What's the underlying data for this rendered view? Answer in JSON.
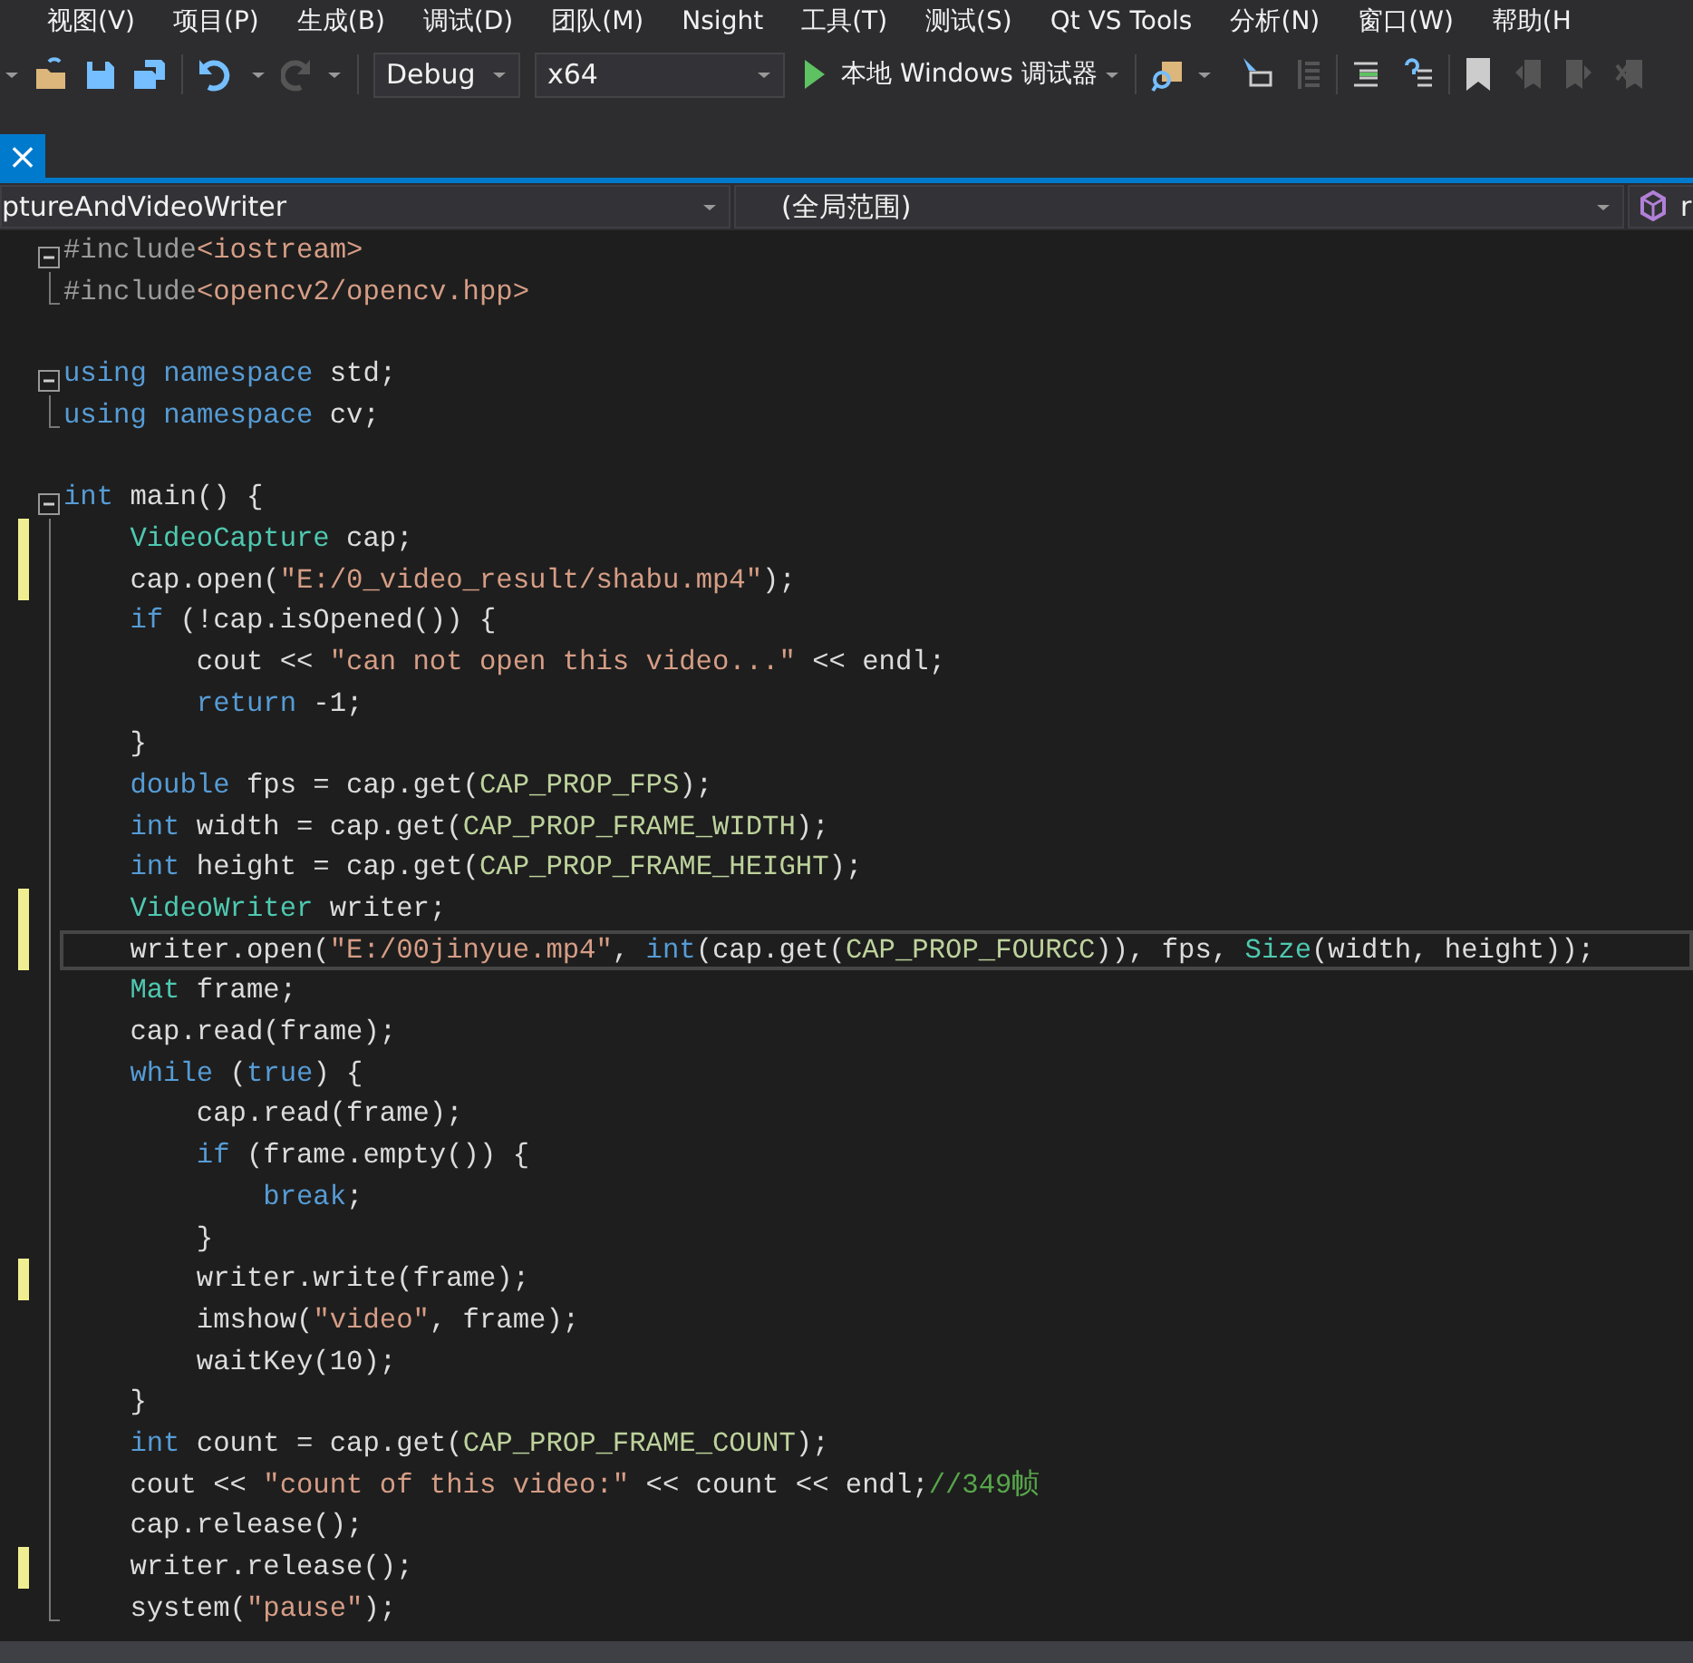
{
  "menu": [
    "视图(V)",
    "项目(P)",
    "生成(B)",
    "调试(D)",
    "团队(M)",
    "Nsight",
    "工具(T)",
    "测试(S)",
    "Qt VS Tools",
    "分析(N)",
    "窗口(W)",
    "帮助(H"
  ],
  "toolbar": {
    "configuration": "Debug",
    "platform": "x64",
    "debugger": "本地 Windows 调试器",
    "redo_disabled": true
  },
  "tab": {
    "close": "×",
    "selected": true
  },
  "navigation": {
    "scope": "ptureAndVideoWriter",
    "range": "(全局范围)",
    "member": "r"
  },
  "lines": [
    {
      "expanded": true,
      "tokens": [
        {
          "kind": "preproc",
          "text": "#include"
        },
        {
          "kind": "string",
          "text": "<iostream>"
        }
      ],
      "children": [
        {
          "tokens": [
            {
              "kind": "preproc",
              "text": "#include"
            },
            {
              "kind": "string",
              "text": "<opencv2/opencv.hpp>"
            }
          ]
        }
      ]
    },
    {
      "gap_before": true,
      "expanded": true,
      "tokens": [
        {
          "kind": "keyword",
          "text": "using"
        },
        {
          "kind": "keyword",
          "text": " namespace"
        },
        {
          "kind": "plain",
          "text": " std;"
        }
      ],
      "children": [
        {
          "tokens": [
            {
              "kind": "keyword",
              "text": "using"
            },
            {
              "kind": "keyword",
              "text": " namespace"
            },
            {
              "kind": "plain",
              "text": " cv;"
            }
          ]
        }
      ]
    },
    {
      "gap_before": true,
      "expanded": true,
      "tokens": [
        {
          "kind": "keyword",
          "text": "int"
        },
        {
          "kind": "plain",
          "text": " main() {"
        }
      ],
      "children": [
        {
          "changed": true,
          "tokens": [
            {
              "kind": "type",
              "text": "    VideoCapture"
            },
            {
              "kind": "plain",
              "text": " cap;"
            }
          ]
        },
        {
          "changed": true,
          "tokens": [
            {
              "kind": "plain",
              "text": "    cap.open("
            },
            {
              "kind": "string",
              "text": "\"E:/0_video_result/shabu.mp4\""
            },
            {
              "kind": "plain",
              "text": ");"
            }
          ]
        },
        {
          "tokens": [
            {
              "kind": "keyword",
              "text": "    if"
            },
            {
              "kind": "plain",
              "text": " (!cap.isOpened()) {"
            }
          ]
        },
        {
          "tokens": [
            {
              "kind": "plain",
              "text": "        cout << "
            },
            {
              "kind": "string",
              "text": "\"can not open this video...\""
            },
            {
              "kind": "plain",
              "text": " << endl;"
            }
          ]
        },
        {
          "tokens": [
            {
              "kind": "keyword",
              "text": "        return"
            },
            {
              "kind": "plain",
              "text": " -1;"
            }
          ]
        },
        {
          "tokens": [
            {
              "kind": "plain",
              "text": "    }"
            }
          ]
        },
        {
          "tokens": [
            {
              "kind": "keyword",
              "text": "    double"
            },
            {
              "kind": "plain",
              "text": " fps = cap.get("
            },
            {
              "kind": "macro",
              "text": "CAP_PROP_FPS"
            },
            {
              "kind": "plain",
              "text": ");"
            }
          ]
        },
        {
          "tokens": [
            {
              "kind": "keyword",
              "text": "    int"
            },
            {
              "kind": "plain",
              "text": " width = cap.get("
            },
            {
              "kind": "macro",
              "text": "CAP_PROP_FRAME_WIDTH"
            },
            {
              "kind": "plain",
              "text": ");"
            }
          ]
        },
        {
          "tokens": [
            {
              "kind": "keyword",
              "text": "    int"
            },
            {
              "kind": "plain",
              "text": " height = cap.get("
            },
            {
              "kind": "macro",
              "text": "CAP_PROP_FRAME_HEIGHT"
            },
            {
              "kind": "plain",
              "text": ");"
            }
          ]
        },
        {
          "changed": true,
          "tokens": [
            {
              "kind": "type",
              "text": "    VideoWriter"
            },
            {
              "kind": "plain",
              "text": " writer;"
            }
          ]
        },
        {
          "changed": true,
          "current": true,
          "tokens": [
            {
              "kind": "plain",
              "text": "    writer.open("
            },
            {
              "kind": "string",
              "text": "\"E:/00jinyue.mp4\""
            },
            {
              "kind": "plain",
              "text": ", "
            },
            {
              "kind": "keyword",
              "text": "int"
            },
            {
              "kind": "plain",
              "text": "(cap.get("
            },
            {
              "kind": "macro",
              "text": "CAP_PROP_FOURCC"
            },
            {
              "kind": "plain",
              "text": ")), fps, "
            },
            {
              "kind": "type",
              "text": "Size"
            },
            {
              "kind": "plain",
              "text": "(width, height));"
            }
          ]
        },
        {
          "tokens": [
            {
              "kind": "type",
              "text": "    Mat"
            },
            {
              "kind": "plain",
              "text": " frame;"
            }
          ]
        },
        {
          "tokens": [
            {
              "kind": "plain",
              "text": "    cap.read(frame);"
            }
          ]
        },
        {
          "tokens": [
            {
              "kind": "keyword",
              "text": "    while"
            },
            {
              "kind": "plain",
              "text": " ("
            },
            {
              "kind": "keyword",
              "text": "true"
            },
            {
              "kind": "plain",
              "text": ") {"
            }
          ]
        },
        {
          "tokens": [
            {
              "kind": "plain",
              "text": "        cap.read(frame);"
            }
          ]
        },
        {
          "tokens": [
            {
              "kind": "keyword",
              "text": "        if"
            },
            {
              "kind": "plain",
              "text": " (frame.empty()) {"
            }
          ]
        },
        {
          "tokens": [
            {
              "kind": "keyword",
              "text": "            break"
            },
            {
              "kind": "plain",
              "text": ";"
            }
          ]
        },
        {
          "tokens": [
            {
              "kind": "plain",
              "text": "        }"
            }
          ]
        },
        {
          "changed": true,
          "tokens": [
            {
              "kind": "plain",
              "text": "        writer.write(frame);"
            }
          ]
        },
        {
          "tokens": [
            {
              "kind": "plain",
              "text": "        imshow("
            },
            {
              "kind": "string",
              "text": "\"video\""
            },
            {
              "kind": "plain",
              "text": ", frame);"
            }
          ]
        },
        {
          "tokens": [
            {
              "kind": "plain",
              "text": "        waitKey(10);"
            }
          ]
        },
        {
          "tokens": [
            {
              "kind": "plain",
              "text": "    }"
            }
          ]
        },
        {
          "tokens": [
            {
              "kind": "keyword",
              "text": "    int"
            },
            {
              "kind": "plain",
              "text": " count = cap.get("
            },
            {
              "kind": "macro",
              "text": "CAP_PROP_FRAME_COUNT"
            },
            {
              "kind": "plain",
              "text": ");"
            }
          ]
        },
        {
          "tokens": [
            {
              "kind": "plain",
              "text": "    cout << "
            },
            {
              "kind": "string",
              "text": "\"count of this video:\""
            },
            {
              "kind": "plain",
              "text": " << count << endl;"
            },
            {
              "kind": "comment",
              "text": "//349帧"
            }
          ]
        },
        {
          "tokens": [
            {
              "kind": "plain",
              "text": "    cap.release();"
            }
          ]
        },
        {
          "changed": true,
          "tokens": [
            {
              "kind": "plain",
              "text": "    writer.release();"
            }
          ]
        },
        {
          "tokens": [
            {
              "kind": "plain",
              "text": "    system("
            },
            {
              "kind": "string",
              "text": "\"pause\""
            },
            {
              "kind": "plain",
              "text": ");"
            }
          ]
        }
      ]
    }
  ]
}
